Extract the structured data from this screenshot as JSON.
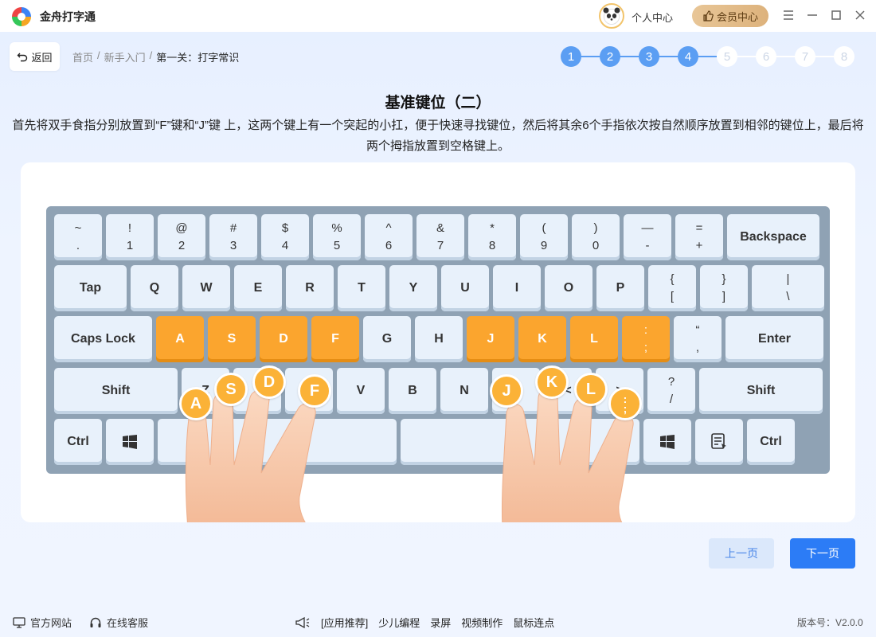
{
  "app": {
    "name": "金舟打字通"
  },
  "header": {
    "user_center": "个人中心",
    "vip_center": "会员中心"
  },
  "nav": {
    "back": "返回",
    "breadcrumb": [
      "首页",
      "新手入门",
      "第一关：打字常识"
    ],
    "separator": "/"
  },
  "steps": [
    {
      "label": "1",
      "active": true
    },
    {
      "label": "2",
      "active": true
    },
    {
      "label": "3",
      "active": true
    },
    {
      "label": "4",
      "active": true
    },
    {
      "label": "5",
      "active": false
    },
    {
      "label": "6",
      "active": false
    },
    {
      "label": "7",
      "active": false
    },
    {
      "label": "8",
      "active": false
    }
  ],
  "lesson": {
    "title": "基准键位（二）",
    "description": "首先将双手食指分别放置到“F”键和“J”键 上，这两个键上有一个突起的小扛，便于快速寻找键位，然后将其余6个手指依次按自然顺序放置到相邻的键位上，最后将两个拇指放置到空格键上。"
  },
  "keyboard": {
    "row1": [
      {
        "top": "~",
        "bot": "."
      },
      {
        "top": "!",
        "bot": "1"
      },
      {
        "top": "@",
        "bot": "2"
      },
      {
        "top": "#",
        "bot": "3"
      },
      {
        "top": "$",
        "bot": "4"
      },
      {
        "top": "%",
        "bot": "5"
      },
      {
        "top": "^",
        "bot": "6"
      },
      {
        "top": "&",
        "bot": "7"
      },
      {
        "top": "*",
        "bot": "8"
      },
      {
        "top": "(",
        "bot": "9"
      },
      {
        "top": ")",
        "bot": "0"
      },
      {
        "top": "—",
        "bot": "-"
      },
      {
        "top": "=",
        "bot": "+"
      },
      {
        "label": "Backspace"
      }
    ],
    "row2": [
      {
        "label": "Tap"
      },
      {
        "label": "Q"
      },
      {
        "label": "W"
      },
      {
        "label": "E"
      },
      {
        "label": "R"
      },
      {
        "label": "T"
      },
      {
        "label": "Y"
      },
      {
        "label": "U"
      },
      {
        "label": "I"
      },
      {
        "label": "O"
      },
      {
        "label": "P"
      },
      {
        "top": "{",
        "bot": "["
      },
      {
        "top": "}",
        "bot": "]"
      },
      {
        "top": "|",
        "bot": "\\"
      }
    ],
    "row3": [
      {
        "label": "Caps Lock"
      },
      {
        "label": "A",
        "hl": true
      },
      {
        "label": "S",
        "hl": true
      },
      {
        "label": "D",
        "hl": true
      },
      {
        "label": "F",
        "hl": true
      },
      {
        "label": "G"
      },
      {
        "label": "H"
      },
      {
        "label": "J",
        "hl": true
      },
      {
        "label": "K",
        "hl": true
      },
      {
        "label": "L",
        "hl": true
      },
      {
        "top": ":",
        "bot": ";",
        "hl": true
      },
      {
        "top": "“",
        "bot": ","
      },
      {
        "label": "Enter"
      }
    ],
    "row4": [
      {
        "label": "Shift"
      },
      {
        "label": "Z"
      },
      {
        "label": "X"
      },
      {
        "label": "C"
      },
      {
        "label": "V"
      },
      {
        "label": "B"
      },
      {
        "label": "N"
      },
      {
        "label": "M"
      },
      {
        "label": "<"
      },
      {
        "label": ">"
      },
      {
        "top": "?",
        "bot": "/"
      },
      {
        "label": "Shift"
      }
    ],
    "row5": [
      {
        "label": "Ctrl"
      },
      {
        "icon": "windows-icon"
      },
      {
        "label": ""
      },
      {
        "label": ""
      },
      {
        "icon": "windows-icon"
      },
      {
        "icon": "menu-key-icon"
      },
      {
        "label": "Ctrl"
      }
    ]
  },
  "fingers": {
    "left": [
      "A",
      "S",
      "D",
      "F"
    ],
    "right": [
      "J",
      "K",
      "L"
    ],
    "semicolon": {
      "top": ":",
      "bot": ";"
    }
  },
  "buttons": {
    "prev": "上一页",
    "next": "下一页"
  },
  "footer": {
    "official_site": "官方网站",
    "online_service": "在线客服",
    "links": [
      "[应用推荐]",
      "少儿编程",
      "录屏",
      "视频制作",
      "鼠标连点"
    ],
    "version": "版本号：V2.0.0"
  }
}
